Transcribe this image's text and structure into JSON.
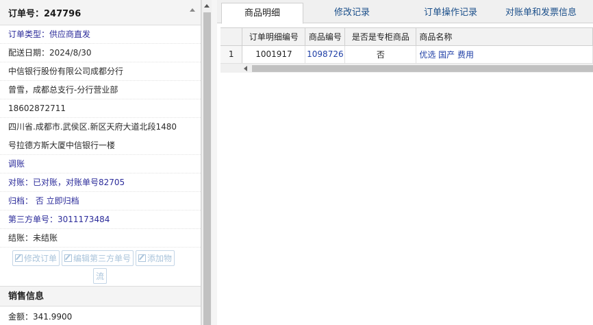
{
  "order_panel": {
    "title": "订单号：247796",
    "rows": [
      {
        "text": "订单类型：供应商直发"
      },
      {
        "text": "配送日期：2024/8/30"
      },
      {
        "text": "中信银行股份有限公司成都分行"
      },
      {
        "text": "曾雪，成都总支行-分行营业部"
      },
      {
        "text": "18602872711"
      },
      {
        "text": "四川省.成都市.武侯区.新区天府大道北段1480"
      },
      {
        "text": "号拉德方斯大厦中信银行一楼"
      },
      {
        "text": "调账"
      },
      {
        "text": "对账：已对账，对账单号82705"
      },
      {
        "text": "归档： 否 立即归档"
      },
      {
        "text": "第三方单号：3011173484"
      },
      {
        "text": "结账：未结账"
      }
    ],
    "actions": {
      "modify_order": "修改订单",
      "edit_third_party": "编辑第三方单号",
      "add_logistics_line1": "添加物",
      "add_logistics_line2": "流"
    }
  },
  "sales_section": {
    "title": "销售信息",
    "amount": "金额：341.9900"
  },
  "tabs": [
    {
      "label": "商品明细",
      "active": true
    },
    {
      "label": "修改记录",
      "active": false
    },
    {
      "label": "订单操作记录",
      "active": false
    },
    {
      "label": "对账单和发票信息",
      "active": false
    }
  ],
  "grid": {
    "columns": [
      "",
      "订单明细编号",
      "商品编号",
      "是否是专柜商品",
      "商品名称"
    ],
    "rows": [
      {
        "rownum": "1",
        "detail_id": "1001917",
        "product_id": "1098726",
        "is_counter": "否",
        "name": "优选 国产 费用"
      }
    ]
  },
  "colors": {
    "link_blue": "#1f3fa6",
    "label_blue": "#2b2b9a",
    "tab_blue": "#1b4f8a",
    "button_disabled": "#aac4db"
  },
  "icons": [
    "edit-icon",
    "collapse-up-icon",
    "scroll-up-icon",
    "scroll-left-icon"
  ]
}
